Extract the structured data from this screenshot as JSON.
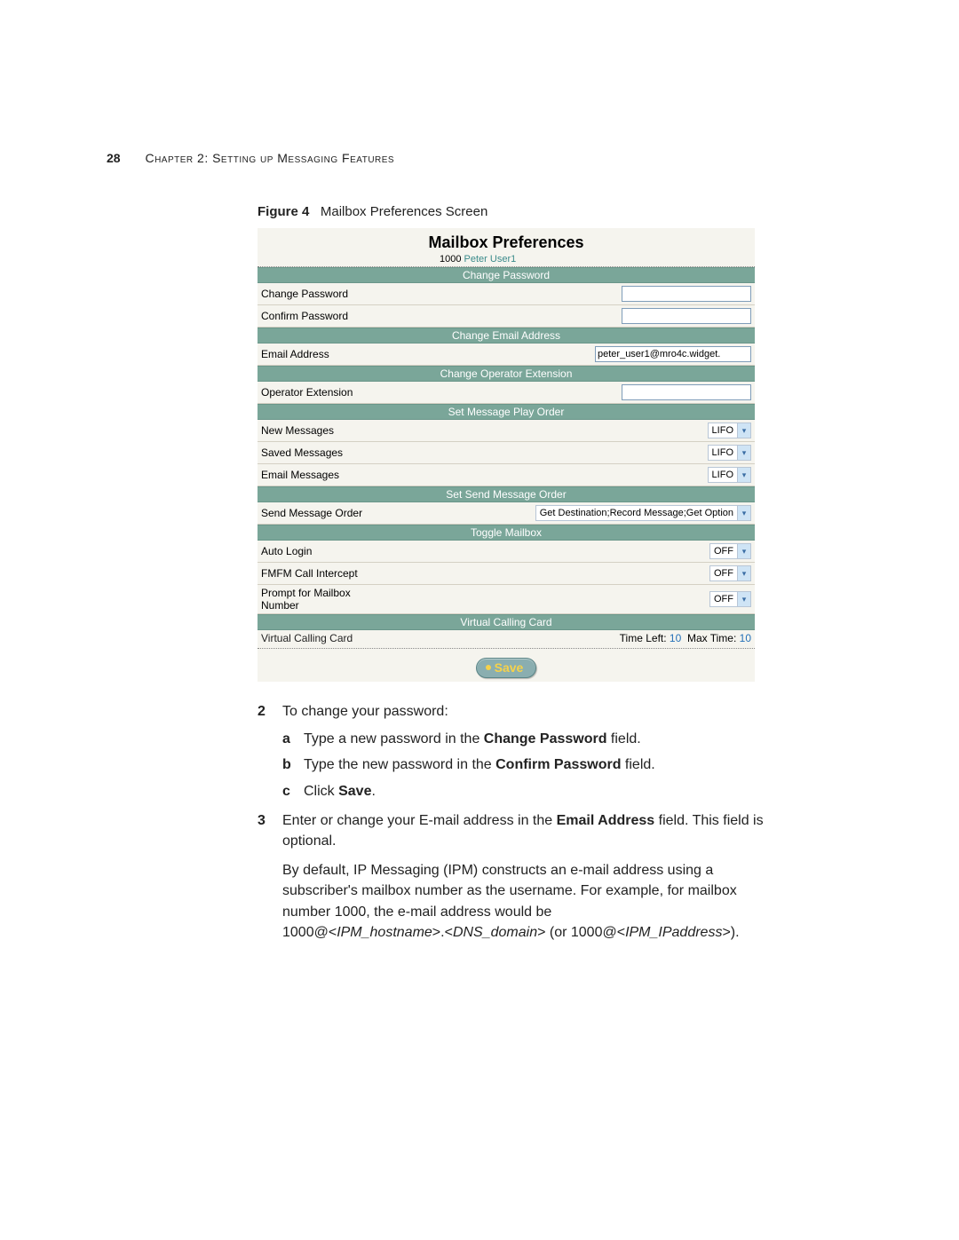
{
  "page_number": "28",
  "chapter_label": "Chapter 2: Setting up Messaging Features",
  "figure_caption": {
    "prefix": "Figure 4",
    "text": "Mailbox Preferences Screen"
  },
  "screenshot": {
    "title": "Mailbox Preferences",
    "user": {
      "id": "1000",
      "name": "Peter User1"
    },
    "change_password": {
      "header": "Change Password",
      "change_label": "Change Password",
      "confirm_label": "Confirm Password",
      "change_value": "",
      "confirm_value": ""
    },
    "change_email": {
      "header": "Change Email Address",
      "label": "Email Address",
      "value": "peter_user1@mro4c.widget."
    },
    "operator_ext": {
      "header": "Change Operator Extension",
      "label": "Operator Extension",
      "value": ""
    },
    "play_order": {
      "header": "Set Message Play Order",
      "rows": [
        {
          "label": "New Messages",
          "value": "LIFO"
        },
        {
          "label": "Saved Messages",
          "value": "LIFO"
        },
        {
          "label": "Email Messages",
          "value": "LIFO"
        }
      ]
    },
    "send_order": {
      "header": "Set Send Message Order",
      "label": "Send Message Order",
      "value": "Get Destination;Record Message;Get Option"
    },
    "toggle_mailbox": {
      "header": "Toggle Mailbox",
      "rows": [
        {
          "label": "Auto Login",
          "value": "OFF"
        },
        {
          "label": "FMFM Call Intercept",
          "value": "OFF"
        },
        {
          "label": "Prompt for Mailbox Number",
          "value": "OFF"
        }
      ]
    },
    "virtual_card": {
      "header": "Virtual Calling Card",
      "label": "Virtual Calling Card",
      "time_left_label": "Time Left:",
      "time_left_value": "10",
      "max_time_label": "Max Time:",
      "max_time_value": "10"
    },
    "save_label": "Save"
  },
  "body": {
    "step2_num": "2",
    "step2": "To change your password:",
    "step2a_letter": "a",
    "step2a_pre": "Type a new password in the ",
    "step2a_bold": "Change Password",
    "step2a_post": " field.",
    "step2b_letter": "b",
    "step2b_pre": "Type the new password in the ",
    "step2b_bold": "Confirm Password",
    "step2b_post": " field.",
    "step2c_letter": "c",
    "step2c_pre": "Click ",
    "step2c_bold": "Save",
    "step2c_post": ".",
    "step3_num": "3",
    "step3_pre": "Enter or change your E-mail address in the ",
    "step3_bold": "Email Address",
    "step3_post": " field. This field is optional.",
    "step3_para_a": "By default, IP Messaging (IPM) constructs an e-mail address using a subscriber's mailbox number as the username. For example, for mailbox number 1000, the e-mail address would be",
    "step3_addr_pre1": "1000@<",
    "step3_addr_it1": "IPM_hostname",
    "step3_addr_mid1": ">.<",
    "step3_addr_it2": "DNS_domain",
    "step3_addr_mid2": "> (or 1000@<",
    "step3_addr_it3": "IPM_IPaddress",
    "step3_addr_post": ">)."
  }
}
